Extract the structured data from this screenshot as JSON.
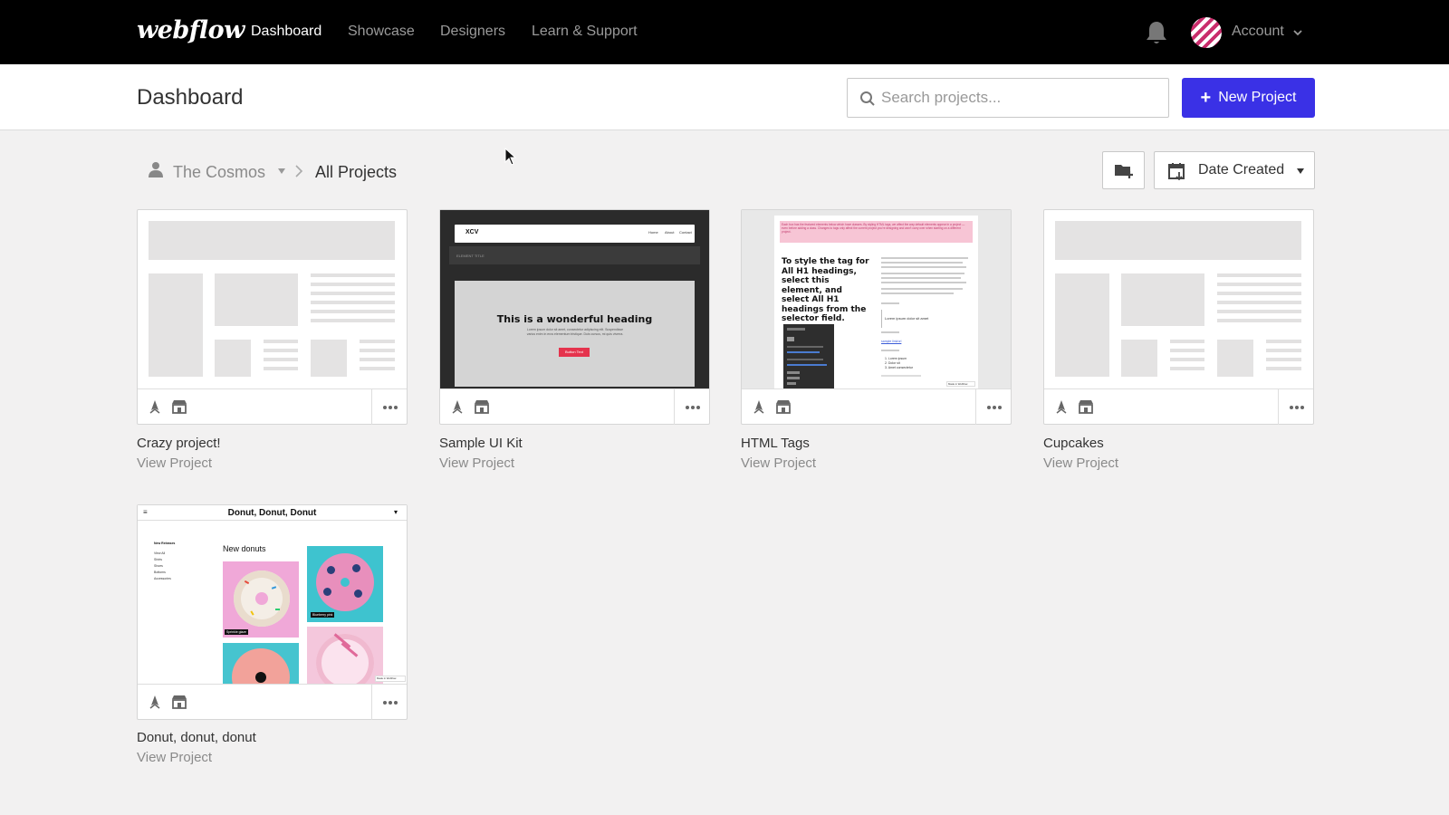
{
  "nav": {
    "logo": "webflow",
    "links": [
      "Dashboard",
      "Showcase",
      "Designers",
      "Learn & Support"
    ],
    "active": "Dashboard",
    "account_label": "Account"
  },
  "header": {
    "title": "Dashboard",
    "search_placeholder": "Search projects...",
    "new_project_label": "New Project",
    "new_project_color": "#3a31e6"
  },
  "breadcrumb": {
    "workspace": "The Cosmos",
    "current": "All Projects"
  },
  "sort": {
    "label": "Date Created"
  },
  "projects": [
    {
      "title": "Crazy project!",
      "link": "View Project"
    },
    {
      "title": "Sample UI Kit",
      "link": "View Project"
    },
    {
      "title": "HTML Tags",
      "link": "View Project"
    },
    {
      "title": "Cupcakes",
      "link": "View Project"
    },
    {
      "title": "Donut, donut, donut",
      "link": "View Project"
    }
  ],
  "thumbs": {
    "kit": {
      "brand": "XCV",
      "nav": [
        "Home",
        "About",
        "Contact"
      ],
      "section": "ELEMENT TITLE",
      "heading": "This is a wonderful heading",
      "body": "Lorem ipsum dolor sit amet, consectetur adipiscing elit. Suspendisse varius enim in eros elementum tristique. Duis cursus, mi quis viverra.",
      "button": "Button Text"
    },
    "tags": {
      "notice": "Each box has the featured elements below which have classes. By styling HTML tags, we affect the way default elements appear in a project — even before adding a class. Changes to tags only affect the current project you're designing and won't carry over when starting on a different project.",
      "heading": "To style the tag for All H1 headings, select this element, and select All H1 headings from the selector field.",
      "quote": "Lorem ipsum dolor sit amet",
      "link": "sample link/url",
      "list_items": [
        "1. Lorem ipsum",
        "2. Dolor sit",
        "3. Amet consectetur"
      ],
      "badge": "Made in Webflow"
    },
    "donut": {
      "title": "Donut, Donut, Donut",
      "menu": [
        "New Releases",
        "View All",
        "Shirts",
        "Shoes",
        "Bottoms",
        "Accessories"
      ],
      "heading": "New donuts",
      "caption1": "Sprinkle glaze",
      "caption2": "Blueberry pink",
      "badge": "Made in Webflow"
    }
  }
}
